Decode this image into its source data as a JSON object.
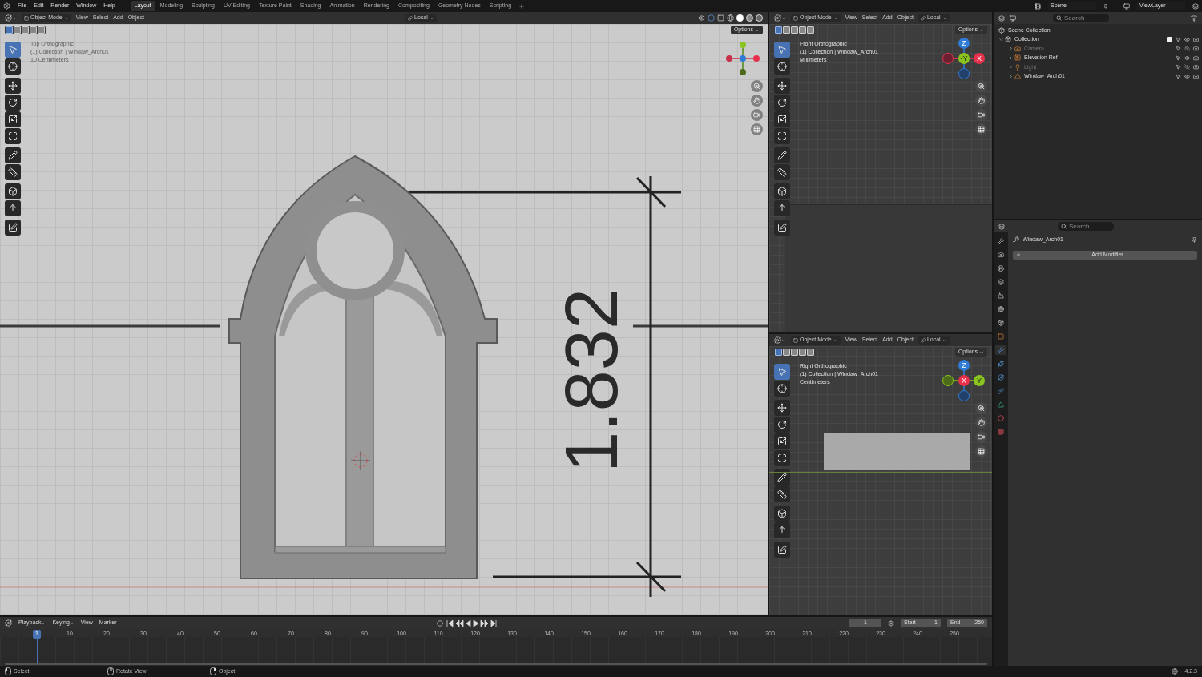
{
  "top_menu": [
    "File",
    "Edit",
    "Render",
    "Window",
    "Help"
  ],
  "workspaces": [
    {
      "label": "Layout",
      "selected": true
    },
    {
      "label": "Modeling",
      "selected": false
    },
    {
      "label": "Sculpting",
      "selected": false
    },
    {
      "label": "UV Editing",
      "selected": false
    },
    {
      "label": "Texture Paint",
      "selected": false
    },
    {
      "label": "Shading",
      "selected": false
    },
    {
      "label": "Animation",
      "selected": false
    },
    {
      "label": "Rendering",
      "selected": false
    },
    {
      "label": "Compositing",
      "selected": false
    },
    {
      "label": "Geometry Nodes",
      "selected": false
    },
    {
      "label": "Scripting",
      "selected": false
    }
  ],
  "scene": "Scene",
  "view_layer": "ViewLayer",
  "main_viewport": {
    "mode": "Object Mode",
    "menus": [
      "View",
      "Select",
      "Add",
      "Object"
    ],
    "orientation": "Local",
    "options": "Options",
    "info": [
      "Top Orthographic",
      "(1) Collection | Windaw_Arch01",
      "10 Centimeters"
    ],
    "reference_dimension": "1.832"
  },
  "side_viewports": [
    {
      "mode": "Object Mode",
      "menus": [
        "View",
        "Select",
        "Add",
        "Object"
      ],
      "orientation": "Local",
      "options": "Options",
      "info": [
        "Front Orthographic",
        "(1) Collection | Windaw_Arch01",
        "Millimeters"
      ],
      "gizmo_labels": [
        "Z",
        "-Y",
        "X"
      ]
    },
    {
      "mode": "Object Mode",
      "menus": [
        "View",
        "Select",
        "Add",
        "Object"
      ],
      "orientation": "Local",
      "options": "Options",
      "info": [
        "Right Orthographic",
        "(1) Collection | Windaw_Arch01",
        "Centimeters"
      ],
      "gizmo_labels": [
        "Z",
        "X",
        "Y"
      ]
    }
  ],
  "select_modes": [
    {
      "selected": true
    },
    {
      "selected": false
    },
    {
      "selected": false
    },
    {
      "selected": false
    },
    {
      "selected": false
    }
  ],
  "tools": [
    {
      "kind": "select",
      "selected": true
    },
    {
      "kind": "cursor",
      "selected": false
    },
    {
      "kind": "move",
      "selected": false
    },
    {
      "kind": "rotate",
      "selected": false
    },
    {
      "kind": "scale",
      "selected": false
    },
    {
      "kind": "transform",
      "selected": false
    },
    {
      "kind": "annotate",
      "selected": false
    },
    {
      "kind": "measure",
      "selected": false
    },
    {
      "kind": "add_cube",
      "selected": false
    },
    {
      "kind": "extrude",
      "selected": false
    },
    {
      "kind": "edit",
      "selected": false
    }
  ],
  "outliner": {
    "search_placeholder": "Search",
    "root": "Scene Collection",
    "items": [
      {
        "name": "Collection",
        "kind": "collection",
        "expanded": true,
        "hidden": false,
        "checked": true,
        "children": [
          {
            "name": "Camera",
            "kind": "camera",
            "expanded": false,
            "hidden": true
          },
          {
            "name": "Elevation Ref",
            "kind": "image",
            "expanded": false,
            "hidden": false
          },
          {
            "name": "Light",
            "kind": "light",
            "expanded": false,
            "hidden": true
          },
          {
            "name": "Windaw_Arch01",
            "kind": "mesh",
            "expanded": false,
            "hidden": false
          }
        ]
      }
    ]
  },
  "properties": {
    "search_placeholder": "Search",
    "object_name": "Windaw_Arch01",
    "add_button": "Add Modifier",
    "tabs": [
      {
        "kind": "tool",
        "selected": false
      },
      {
        "kind": "render",
        "selected": false
      },
      {
        "kind": "output",
        "selected": false
      },
      {
        "kind": "view_layer",
        "selected": false
      },
      {
        "kind": "scene",
        "selected": false
      },
      {
        "kind": "world",
        "selected": false
      },
      {
        "kind": "collection",
        "selected": false
      },
      {
        "kind": "object",
        "selected": false
      },
      {
        "kind": "modifiers",
        "selected": true
      },
      {
        "kind": "particles",
        "selected": false
      },
      {
        "kind": "physics",
        "selected": false
      },
      {
        "kind": "constraints",
        "selected": false
      },
      {
        "kind": "data",
        "selected": false
      },
      {
        "kind": "material",
        "selected": false
      },
      {
        "kind": "texture",
        "selected": false
      }
    ]
  },
  "timeline": {
    "menus": [
      "Playback",
      "Keying",
      "View",
      "Marker"
    ],
    "current_frame": "1",
    "start_label": "Start",
    "start": "1",
    "end_label": "End",
    "end": "250",
    "playhead": "1",
    "ticks": [
      "10",
      "20",
      "30",
      "40",
      "50",
      "60",
      "70",
      "80",
      "90",
      "100",
      "110",
      "120",
      "130",
      "140",
      "150",
      "160",
      "170",
      "180",
      "190",
      "200",
      "210",
      "220",
      "230",
      "240",
      "250"
    ]
  },
  "status_bar": {
    "hints": [
      {
        "kind": "mouse_left",
        "label": "Select"
      },
      {
        "kind": "mouse_middle",
        "label": "Rotate View"
      },
      {
        "kind": "mouse_right",
        "label": "Object"
      }
    ],
    "version": "4.2.3"
  }
}
